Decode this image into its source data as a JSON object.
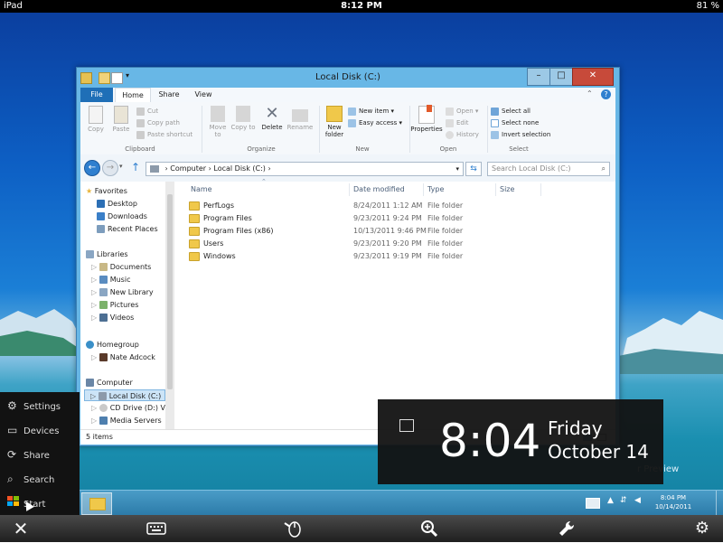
{
  "ios_status": {
    "device": "iPad",
    "time": "8:12 PM",
    "battery": "81 %"
  },
  "window": {
    "title": "Local Disk (C:)",
    "ribbon_tabs": [
      "File",
      "Home",
      "Share",
      "View"
    ],
    "ribbon": {
      "clipboard": {
        "label": "Clipboard",
        "copy": "Copy",
        "paste": "Paste",
        "cut": "Cut",
        "copy_path": "Copy path",
        "paste_shortcut": "Paste shortcut"
      },
      "organize": {
        "label": "Organize",
        "move_to": "Move to",
        "copy_to": "Copy to",
        "delete": "Delete",
        "rename": "Rename"
      },
      "new": {
        "label": "New",
        "new_folder": "New folder",
        "new_item": "New item",
        "easy_access": "Easy access"
      },
      "open": {
        "label": "Open",
        "properties": "Properties",
        "open": "Open",
        "edit": "Edit",
        "history": "History"
      },
      "select": {
        "label": "Select",
        "select_all": "Select all",
        "select_none": "Select none",
        "invert": "Invert selection"
      }
    },
    "address": {
      "crumb1": "Computer",
      "crumb2": "Local Disk (C:)"
    },
    "search_placeholder": "Search Local Disk (C:)",
    "nav": {
      "favorites": "Favorites",
      "desktop": "Desktop",
      "downloads": "Downloads",
      "recent": "Recent Places",
      "libraries": "Libraries",
      "documents": "Documents",
      "music": "Music",
      "newlib": "New Library",
      "pictures": "Pictures",
      "videos": "Videos",
      "homegroup": "Homegroup",
      "user": "Nate Adcock",
      "computer": "Computer",
      "local_disk": "Local Disk (C:)",
      "cd_drive": "CD Drive (D:) Virt",
      "media": "Media Servers"
    },
    "columns": {
      "name": "Name",
      "date": "Date modified",
      "type": "Type",
      "size": "Size"
    },
    "rows": [
      {
        "name": "PerfLogs",
        "date": "8/24/2011 1:12 AM",
        "type": "File folder"
      },
      {
        "name": "Program Files",
        "date": "9/23/2011 9:24 PM",
        "type": "File folder"
      },
      {
        "name": "Program Files (x86)",
        "date": "10/13/2011 9:46 PM",
        "type": "File folder"
      },
      {
        "name": "Users",
        "date": "9/23/2011 9:20 PM",
        "type": "File folder"
      },
      {
        "name": "Windows",
        "date": "9/23/2011 9:19 PM",
        "type": "File folder"
      }
    ],
    "status": "5 items"
  },
  "charms": {
    "settings": "Settings",
    "devices": "Devices",
    "share": "Share",
    "search": "Search",
    "start": "Start"
  },
  "clock": {
    "time": "8:04",
    "day": "Friday",
    "date": "October 14"
  },
  "taskbar": {
    "time": "8:04 PM",
    "date": "10/14/2011",
    "preview": "r Preview"
  },
  "toolbar_icons": [
    "close-icon",
    "keyboard-icon",
    "mouse-icon",
    "zoom-icon",
    "wrench-icon",
    "gear-icon"
  ]
}
